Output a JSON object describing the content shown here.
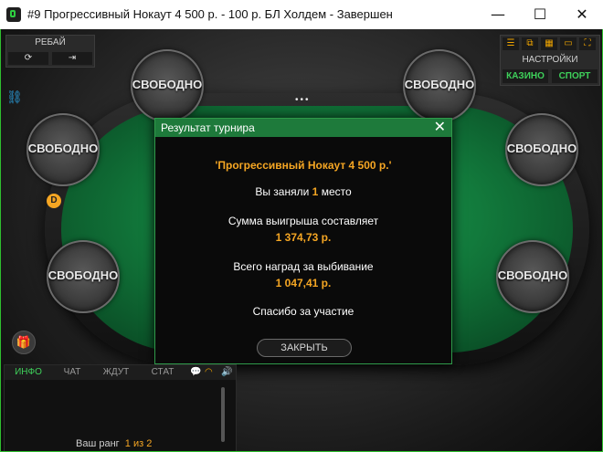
{
  "window": {
    "title": "#9 Прогрессивный Нокаут 4 500 р. - 100 р. БЛ Холдем - Завершен",
    "min_symbol": "—",
    "max_symbol": "☐",
    "close_symbol": "✕"
  },
  "rebuy": {
    "label": "РЕБАЙ",
    "refresh_symbol": "⟳",
    "exit_symbol": "⇥"
  },
  "settings": {
    "label": "НАСТРОЙКИ",
    "casino_label": "КАЗИНО",
    "sport_label": "СПОРТ",
    "icons": [
      "list-icon",
      "layers-icon",
      "grid-icon",
      "camera-icon",
      "fullscreen-icon"
    ]
  },
  "seats": [
    "СВОБОДНО",
    "СВОБОДНО",
    "СВОБОДНО",
    "СВОБОДНО",
    "СВОБОДНО",
    "СВОБОДНО",
    "СВОБОДНО"
  ],
  "table": {
    "top_dots": "•••",
    "dealer_label": "D"
  },
  "dialog": {
    "title": "Результат турнира",
    "close_symbol": "✕",
    "tournament_name": "'Прогрессивный Нокаут 4 500 р.'",
    "place_prefix": "Вы заняли",
    "place_value": "1",
    "place_suffix": "место",
    "winnings_label": "Сумма выигрыша составляет",
    "winnings_value": "1 374,73 р.",
    "bounty_label": "Всего наград за выбивание",
    "bounty_value": "1 047,41 р.",
    "thanks": "Спасибо за участие",
    "close_button": "ЗАКРЫТЬ"
  },
  "chat": {
    "tabs": [
      "ИНФО",
      "ЧАТ",
      "ЖДУТ",
      "СТАТ"
    ],
    "rank_label": "Ваш ранг",
    "rank_value": "1 из 2"
  },
  "colors": {
    "accent_green": "#2fbf2f",
    "orange": "#f5a623",
    "felt": "#127a3c"
  }
}
